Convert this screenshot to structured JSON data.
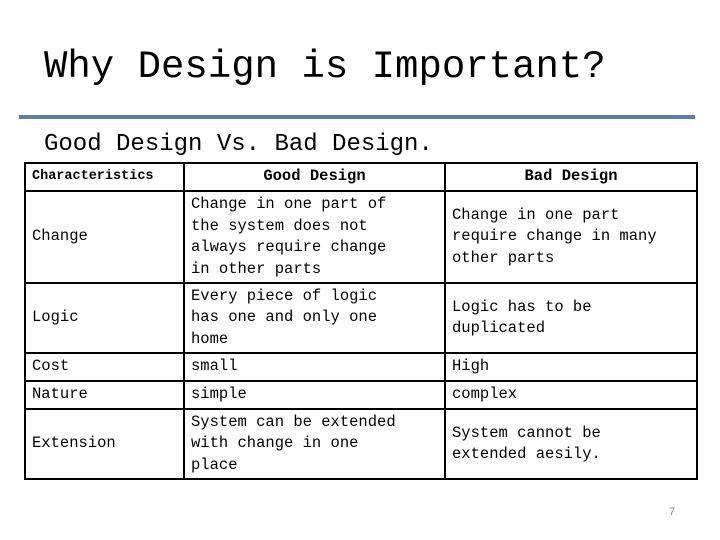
{
  "slide": {
    "title": "Why Design is Important?",
    "subtitle": "Good Design Vs. Bad Design.",
    "page_number": "7",
    "accent_color": "#5b7fa6"
  },
  "table": {
    "headers": [
      "Characteristics",
      "Good Design",
      "Bad Design"
    ],
    "rows": [
      {
        "characteristic": "Change",
        "good": "Change in one part of\nthe system does not\nalways require change\nin other parts",
        "bad": "Change in one part\nrequire change in many\nother parts"
      },
      {
        "characteristic": "Logic",
        "good": "Every piece of logic\nhas one and only one\nhome",
        "bad": "Logic has to be\nduplicated"
      },
      {
        "characteristic": "Cost",
        "good": "small",
        "bad": "High"
      },
      {
        "characteristic": "Nature",
        "good": "simple",
        "bad": "complex"
      },
      {
        "characteristic": "Extension",
        "good": "System can be extended\nwith change in one\nplace",
        "bad": "System cannot be\nextended aesily."
      }
    ]
  }
}
